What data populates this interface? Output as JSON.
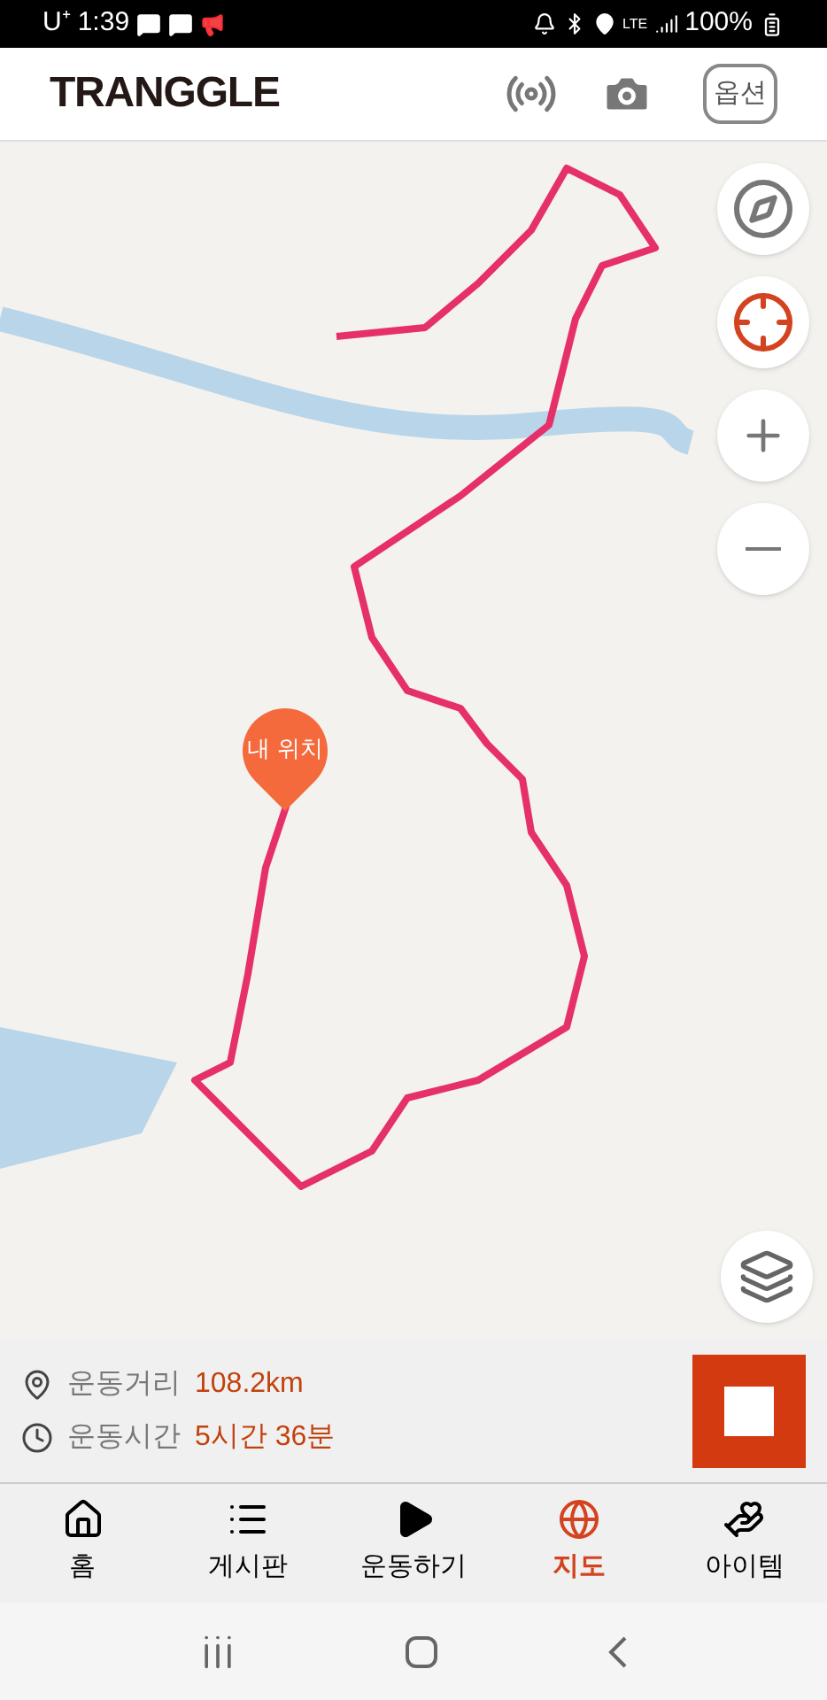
{
  "status_bar": {
    "carrier": "U⁺",
    "time": "1:39",
    "network": "LTE",
    "battery": "100%"
  },
  "header": {
    "logo": "TRANGGLE",
    "options_button": "옵션"
  },
  "map": {
    "my_location": "내 위치"
  },
  "stats": [
    {
      "kind": "distance",
      "label": "운동거리",
      "value": "108.2km"
    },
    {
      "kind": "time",
      "label": "운동시간",
      "value": "5시간 36분"
    }
  ],
  "tabs": [
    {
      "kind": "home",
      "label": "홈",
      "selected": false
    },
    {
      "kind": "board",
      "label": "게시판",
      "selected": false
    },
    {
      "kind": "play",
      "label": "운동하기",
      "selected": false
    },
    {
      "kind": "map",
      "label": "지도",
      "selected": true
    },
    {
      "kind": "item",
      "label": "아이템",
      "selected": false
    }
  ]
}
